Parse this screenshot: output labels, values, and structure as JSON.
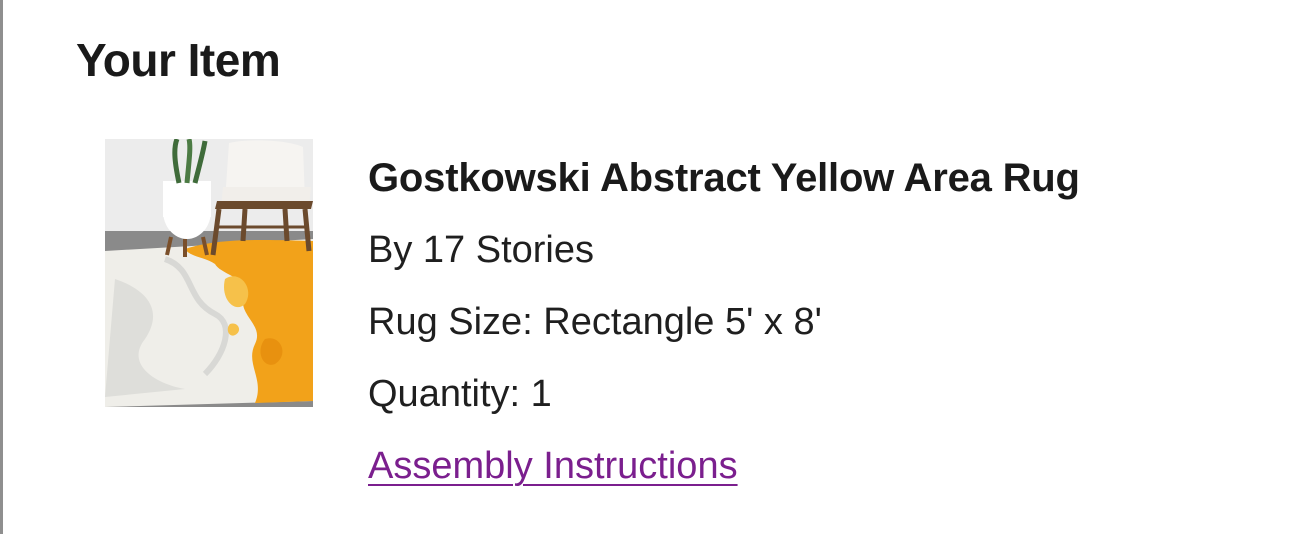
{
  "section": {
    "title": "Your Item"
  },
  "item": {
    "image_icon": "rug-thumbnail",
    "name": "Gostkowski Abstract Yellow Area Rug",
    "brand": "By 17 Stories",
    "size": "Rug Size: Rectangle 5' x 8'",
    "quantity": "Quantity: 1",
    "assembly_link": "Assembly Instructions"
  },
  "colors": {
    "link": "#7b1f8e",
    "text": "#1f1f1f",
    "rug_accent": "#f2a21a"
  }
}
